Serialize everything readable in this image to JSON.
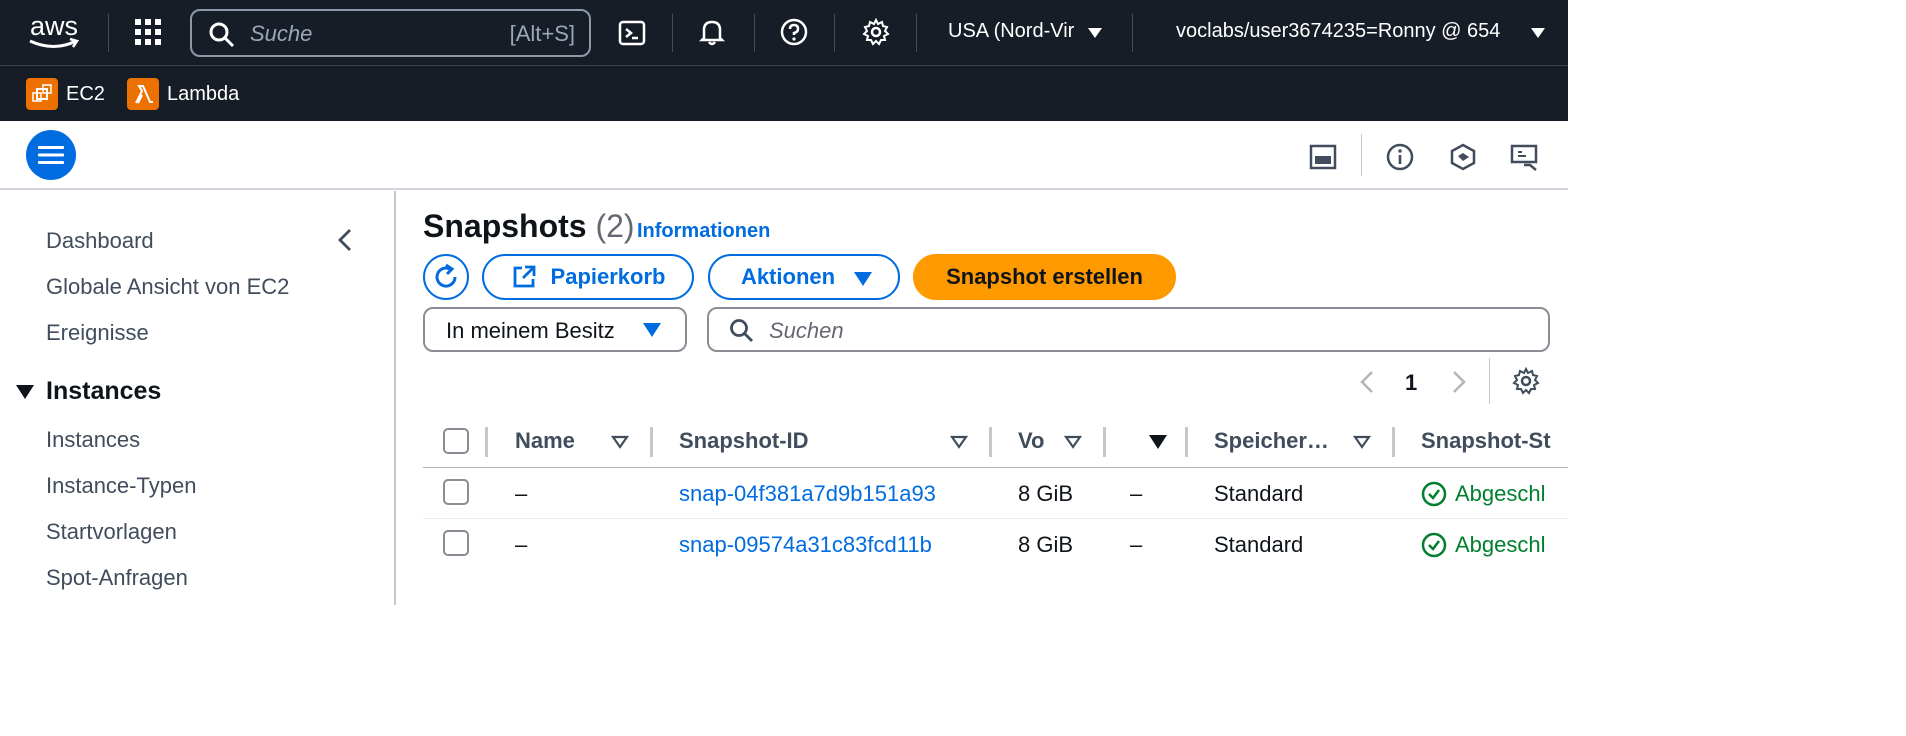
{
  "topbar": {
    "logo": "aws",
    "search_placeholder": "Suche",
    "search_shortcut": "[Alt+S]",
    "region": "USA (Nord-Vir",
    "account": "voclabs/user3674235=Ronny @ 654"
  },
  "favorites": [
    {
      "label": "EC2",
      "color": "#ed7100"
    },
    {
      "label": "Lambda",
      "color": "#ed7100"
    }
  ],
  "sidebar": {
    "items_top": [
      "Dashboard",
      "Globale Ansicht von EC2",
      "Ereignisse"
    ],
    "section": "Instances",
    "section_items": [
      "Instances",
      "Instance-Typen",
      "Startvorlagen",
      "Spot-Anfragen"
    ]
  },
  "page": {
    "title": "Snapshots",
    "count": "(2)",
    "info_link": "Informationen",
    "recycle_bin": "Papierkorb",
    "actions": "Aktionen",
    "create": "Snapshot erstellen",
    "owner_filter": "In meinem Besitz",
    "search_placeholder": "Suchen",
    "page_number": "1"
  },
  "table": {
    "columns": [
      "Name",
      "Snapshot-ID",
      "Vo",
      "",
      "Speicher…",
      "Snapshot-St"
    ],
    "rows": [
      {
        "name": "–",
        "id": "snap-04f381a7d9b151a93",
        "size": "8 GiB",
        "blank": "–",
        "storage": "Standard",
        "status": "Abgeschl"
      },
      {
        "name": "–",
        "id": "snap-09574a31c83fcd11b",
        "size": "8 GiB",
        "blank": "–",
        "storage": "Standard",
        "status": "Abgeschl"
      }
    ]
  },
  "colors": {
    "accent": "#006ce0",
    "primary": "#ff9900",
    "nav_bg": "#161d26",
    "success": "#00802f"
  }
}
